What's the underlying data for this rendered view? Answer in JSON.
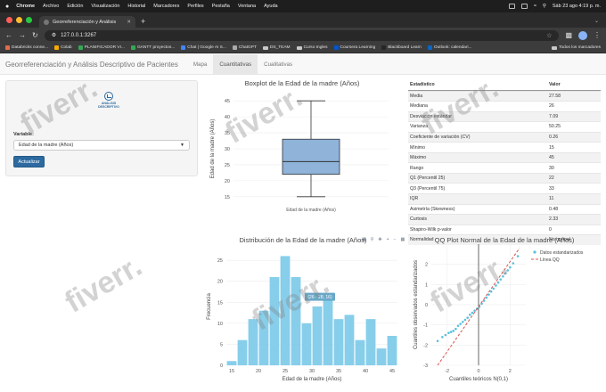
{
  "menubar": {
    "apple": "",
    "items": [
      "Chrome",
      "Archivo",
      "Edición",
      "Visualización",
      "Historial",
      "Marcadores",
      "Perfiles",
      "Pestaña",
      "Ventana",
      "Ayuda"
    ],
    "clock": "Sáb 23 ago 4:19 p. m."
  },
  "browser": {
    "tab_title": "Georreferenciación y Análisis",
    "url": "127.0.0.1:3267",
    "bookmarks": [
      "Databricks conne...",
      "Colab",
      "PLANIFICADOR VI...",
      "GANTT proyectos...",
      "Chat | Google AI S...",
      "ChatGPT",
      "DS_TEAM",
      "Curso Ingles",
      "Coursera Learning",
      "Blackboard Learn",
      "Outlook: calendari..."
    ],
    "all_bookmarks": "Todos los marcadores"
  },
  "app": {
    "title": "Georreferenciación y Análisis Descriptivo de Pacientes",
    "tabs": [
      "Mapa",
      "Cuantitativas",
      "Cualitativas"
    ]
  },
  "sidebar": {
    "logo_text": "ANÁLISIS DESCRIPTIVO",
    "variable_label": "Variable:",
    "variable_value": "Edad de la madre (Años)",
    "button_label": "Actualizar"
  },
  "stats": {
    "headers": [
      "Estadístico",
      "Valor"
    ],
    "rows": [
      [
        "Media",
        "27.58"
      ],
      [
        "Mediana",
        "26"
      ],
      [
        "Desviación estándar",
        "7.09"
      ],
      [
        "Varianza",
        "50.25"
      ],
      [
        "Coeficiente de variación (CV)",
        "0.26"
      ],
      [
        "Mínimo",
        "15"
      ],
      [
        "Máximo",
        "45"
      ],
      [
        "Rango",
        "30"
      ],
      [
        "Q1 (Percentil 25)",
        "22"
      ],
      [
        "Q3 (Percentil 75)",
        "33"
      ],
      [
        "IQR",
        "11"
      ],
      [
        "Asimetría (Skewness)",
        "0.48"
      ],
      [
        "Curtosis",
        "2.33"
      ],
      [
        "Shapiro-Wilk p-valor",
        "0"
      ],
      [
        "Normalidad",
        "No normal"
      ]
    ]
  },
  "watermark": "fiverr.",
  "chart_data": [
    {
      "type": "box",
      "title": "Boxplot de la Edad de la madre (Años)",
      "ylabel": "Edad de la madre (Años)",
      "category": "Edad de la madre (Años)",
      "min": 15,
      "q1": 22,
      "median": 26,
      "q3": 33,
      "max": 45,
      "ylim": [
        13,
        47
      ],
      "yticks": [
        15,
        20,
        25,
        30,
        35,
        40,
        45
      ],
      "color": "#8fb3d9"
    },
    {
      "type": "bar",
      "title": "Distribución de la Edad de la madre (Años)",
      "xlabel": "Edad de la madre (Años)",
      "ylabel": "Frecuencia",
      "bin_edges": [
        14,
        16,
        18,
        20,
        22,
        24,
        26,
        28,
        30,
        32,
        34,
        36,
        38,
        40,
        42,
        44,
        46
      ],
      "values": [
        1,
        6,
        11,
        13,
        21,
        26,
        21,
        10,
        14,
        17,
        11,
        12,
        6,
        11,
        4,
        7,
        3
      ],
      "ylim": [
        0,
        28
      ],
      "yticks": [
        0,
        5,
        10,
        15,
        20,
        25
      ],
      "xticks": [
        15,
        20,
        25,
        30,
        35,
        40,
        45
      ],
      "tooltip": "(26 - 28, 16)",
      "color": "#87ceeb"
    },
    {
      "type": "scatter",
      "title": "QQ Plot Normal de la Edad de la madre (Años)",
      "xlabel": "Cuantiles teóricos N(0,1)",
      "ylabel": "Cuantiles observados estandarizados",
      "xlim": [
        -3,
        3
      ],
      "ylim": [
        -3,
        3
      ],
      "xticks": [
        -2,
        0,
        2
      ],
      "yticks": [
        -3,
        -2,
        -1,
        0,
        1,
        2
      ],
      "legend": [
        "Datos estandarizados",
        "Línea QQ"
      ],
      "legend_position": "top-right",
      "series": [
        {
          "name": "Datos estandarizados",
          "x": [
            -2.6,
            -2.3,
            -2.1,
            -1.9,
            -1.75,
            -1.6,
            -1.45,
            -1.3,
            -1.15,
            -1.0,
            -0.85,
            -0.7,
            -0.55,
            -0.4,
            -0.25,
            -0.1,
            0.05,
            0.2,
            0.35,
            0.5,
            0.65,
            0.8,
            0.95,
            1.1,
            1.25,
            1.4,
            1.55,
            1.7,
            1.85,
            2.0,
            2.2,
            2.5
          ],
          "y": [
            -1.8,
            -1.6,
            -1.5,
            -1.4,
            -1.35,
            -1.3,
            -1.2,
            -1.05,
            -0.95,
            -0.85,
            -0.75,
            -0.65,
            -0.5,
            -0.4,
            -0.3,
            -0.2,
            -0.1,
            0.05,
            0.2,
            0.35,
            0.5,
            0.65,
            0.8,
            0.95,
            1.1,
            1.25,
            1.4,
            1.55,
            1.7,
            1.85,
            2.05,
            2.4
          ],
          "color": "#5bc0de"
        },
        {
          "name": "Línea QQ",
          "x": [
            -2.6,
            2.6
          ],
          "y": [
            -3.0,
            2.8
          ],
          "color": "#d9534f"
        }
      ]
    }
  ]
}
